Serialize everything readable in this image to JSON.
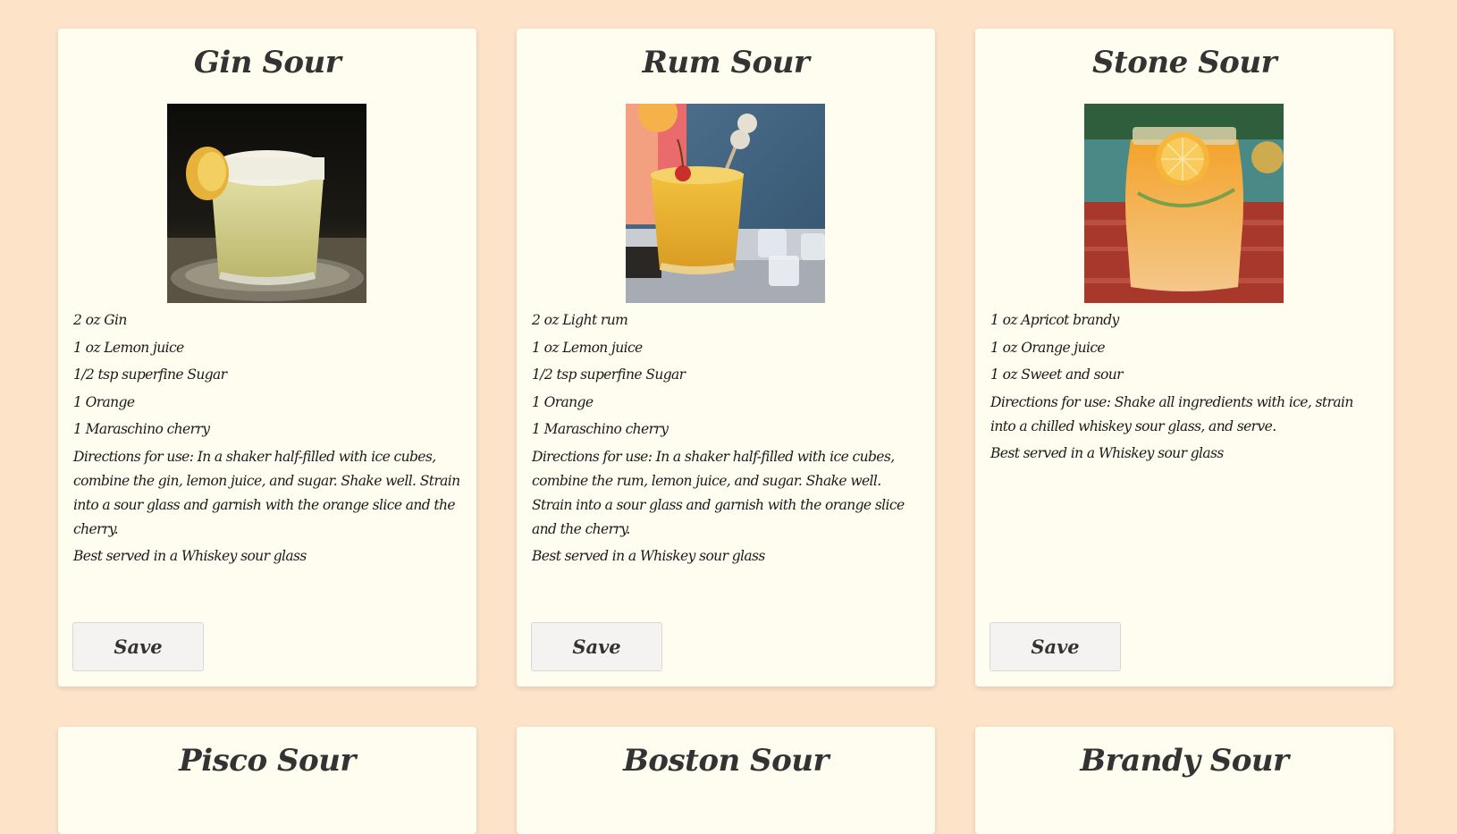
{
  "cards": [
    {
      "title": "Gin Sour",
      "image_name": "gin-sour-photo",
      "ingredients": [
        "2 oz Gin",
        "1 oz Lemon juice",
        "1/2 tsp superfine Sugar",
        "1 Orange",
        "1 Maraschino cherry"
      ],
      "directions": "Directions for use: In a shaker half-filled with ice cubes, combine the gin, lemon juice, and sugar. Shake well. Strain into a sour glass and garnish with the orange slice and the cherry.",
      "glass": "Best served in a Whiskey sour glass",
      "save_label": "Save"
    },
    {
      "title": "Rum Sour",
      "image_name": "rum-sour-photo",
      "ingredients": [
        "2 oz Light rum",
        "1 oz Lemon juice",
        "1/2 tsp superfine Sugar",
        "1 Orange",
        "1 Maraschino cherry"
      ],
      "directions": "Directions for use: In a shaker half-filled with ice cubes, combine the rum, lemon juice, and sugar. Shake well. Strain into a sour glass and garnish with the orange slice and the cherry.",
      "glass": "Best served in a Whiskey sour glass",
      "save_label": "Save"
    },
    {
      "title": "Stone Sour",
      "image_name": "stone-sour-photo",
      "ingredients": [
        "1 oz Apricot brandy",
        "1 oz Orange juice",
        "1 oz Sweet and sour"
      ],
      "directions": "Directions for use: Shake all ingredients with ice, strain into a chilled whiskey sour glass, and serve.",
      "glass": "Best served in a Whiskey sour glass",
      "save_label": "Save"
    },
    {
      "title": "Pisco Sour"
    },
    {
      "title": "Boston Sour"
    },
    {
      "title": "Brandy Sour"
    }
  ],
  "colors": {
    "page_background": "#fde3c8",
    "card_background": "#fefdef",
    "button_background": "#f4f3f2",
    "text": "#222222"
  }
}
